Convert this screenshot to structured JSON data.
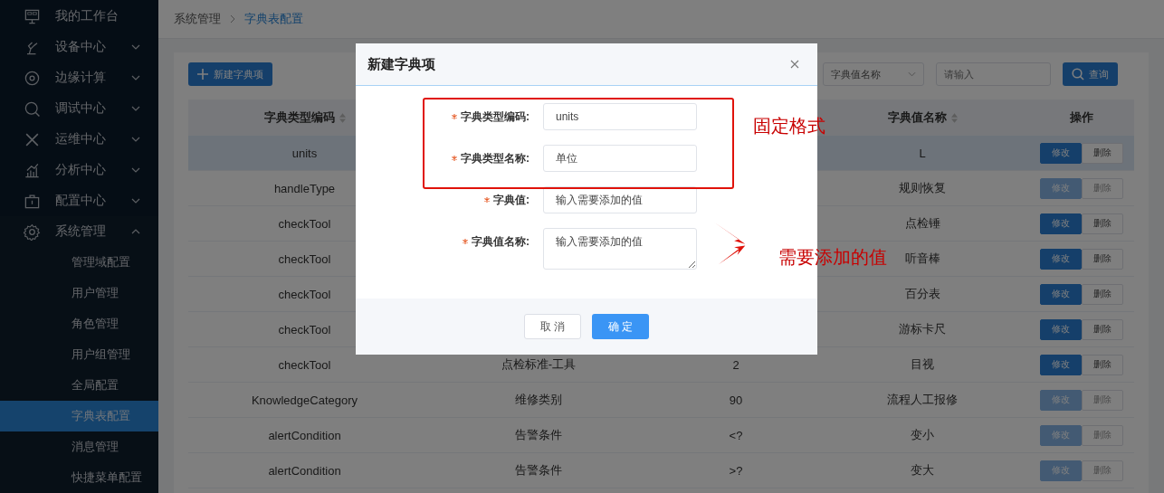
{
  "sidebar": {
    "items": [
      {
        "label": "我的工作台"
      },
      {
        "label": "设备中心",
        "expanded": false
      },
      {
        "label": "边缘计算",
        "expanded": false
      },
      {
        "label": "调试中心",
        "expanded": false
      },
      {
        "label": "运维中心",
        "expanded": false
      },
      {
        "label": "分析中心",
        "expanded": false
      },
      {
        "label": "配置中心",
        "expanded": false
      },
      {
        "label": "系统管理",
        "expanded": true,
        "children": [
          {
            "label": "管理域配置",
            "selected": false
          },
          {
            "label": "用户管理",
            "selected": false
          },
          {
            "label": "角色管理",
            "selected": false
          },
          {
            "label": "用户组管理",
            "selected": false
          },
          {
            "label": "全局配置",
            "selected": false
          },
          {
            "label": "字典表配置",
            "selected": true
          },
          {
            "label": "消息管理",
            "selected": false
          },
          {
            "label": "快捷菜单配置",
            "selected": false
          }
        ]
      }
    ]
  },
  "breadcrumb": [
    {
      "label": "系统管理"
    },
    {
      "label": "字典表配置"
    }
  ],
  "toolbar": {
    "new_button": "新建字典项",
    "filter_select": "字典值名称",
    "filter_input": {
      "placeholder": "请输入"
    },
    "search_button": "查询"
  },
  "table": {
    "columns": [
      {
        "label": "字典类型编码",
        "sortable": true
      },
      {},
      {},
      {
        "label": "字典值名称",
        "sortable": true
      },
      {
        "label": "操作",
        "sortable": false
      }
    ],
    "rows": [
      {
        "cells": [
          "units",
          "",
          "",
          "L"
        ],
        "selected": true,
        "disabled": false,
        "actions": [
          "修改",
          "删除"
        ]
      },
      {
        "cells": [
          "handleType",
          "",
          "",
          "规则恢复"
        ],
        "selected": false,
        "disabled": true,
        "actions": [
          "修改",
          "删除"
        ]
      },
      {
        "cells": [
          "checkTool",
          "",
          "",
          "点检锤"
        ],
        "selected": false,
        "disabled": false,
        "actions": [
          "修改",
          "删除"
        ]
      },
      {
        "cells": [
          "checkTool",
          "",
          "",
          "听音棒"
        ],
        "selected": false,
        "disabled": false,
        "actions": [
          "修改",
          "删除"
        ]
      },
      {
        "cells": [
          "checkTool",
          "",
          "",
          "百分表"
        ],
        "selected": false,
        "disabled": false,
        "actions": [
          "修改",
          "删除"
        ]
      },
      {
        "cells": [
          "checkTool",
          "",
          "",
          "游标卡尺"
        ],
        "selected": false,
        "disabled": false,
        "actions": [
          "修改",
          "删除"
        ]
      },
      {
        "cells": [
          "checkTool",
          "点检标准-工具",
          "2",
          "目视"
        ],
        "selected": false,
        "disabled": false,
        "actions": [
          "修改",
          "删除"
        ]
      },
      {
        "cells": [
          "KnowledgeCategory",
          "维修类别",
          "90",
          "流程人工报修"
        ],
        "selected": false,
        "disabled": true,
        "actions": [
          "修改",
          "删除"
        ]
      },
      {
        "cells": [
          "alertCondition",
          "告警条件",
          "<?",
          "变小"
        ],
        "selected": false,
        "disabled": true,
        "actions": [
          "修改",
          "删除"
        ]
      },
      {
        "cells": [
          "alertCondition",
          "告警条件",
          ">?",
          "变大"
        ],
        "selected": false,
        "disabled": true,
        "actions": [
          "修改",
          "删除"
        ]
      }
    ]
  },
  "dialog": {
    "title": "新建字典项",
    "fields": [
      {
        "label": "字典类型编码:",
        "required": true,
        "kind": "input",
        "value": "units"
      },
      {
        "label": "字典类型名称:",
        "required": true,
        "kind": "input",
        "value": "单位"
      },
      {
        "label": "字典值:",
        "required": true,
        "kind": "input",
        "value": "输入需要添加的值"
      },
      {
        "label": "字典值名称:",
        "required": true,
        "kind": "textarea",
        "value": "输入需要添加的值"
      }
    ],
    "cancel_button": "取 消",
    "confirm_button": "确 定"
  },
  "annotations": [
    {
      "kind": "box-note",
      "text": "固定格式"
    },
    {
      "kind": "arrow-note",
      "text": "需要添加的值"
    }
  ]
}
